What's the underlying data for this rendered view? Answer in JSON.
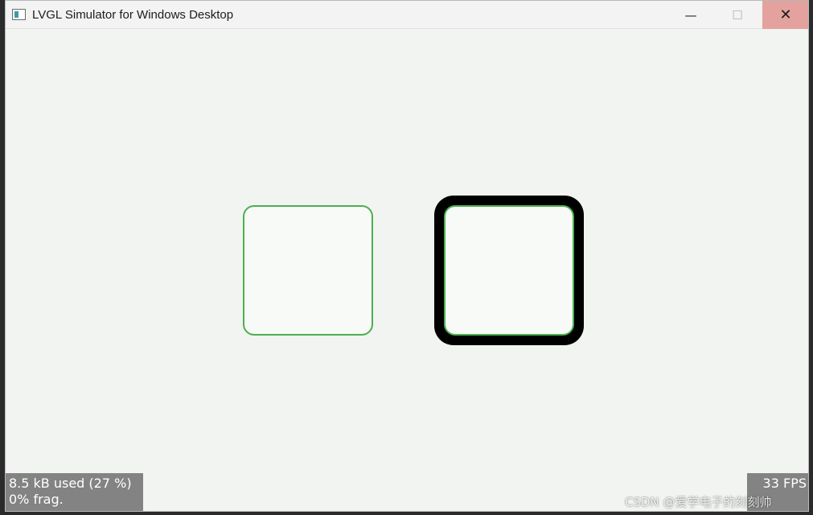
{
  "window": {
    "title": "LVGL Simulator for Windows Desktop",
    "controls": {
      "minimize_glyph": "—",
      "maximize_glyph": "☐",
      "close_glyph": "✕"
    }
  },
  "colors": {
    "accent_green": "#4caf50",
    "outline": "#000000",
    "background": "#f1f4f1",
    "close_hover": "#e3a29d"
  },
  "perf_monitor": {
    "memory_used": "8.5 kB used (27 %)",
    "fragmentation": "0% frag.",
    "fps": "33 FPS"
  },
  "watermark": "CSDN @爱学电子的刻刻帅"
}
